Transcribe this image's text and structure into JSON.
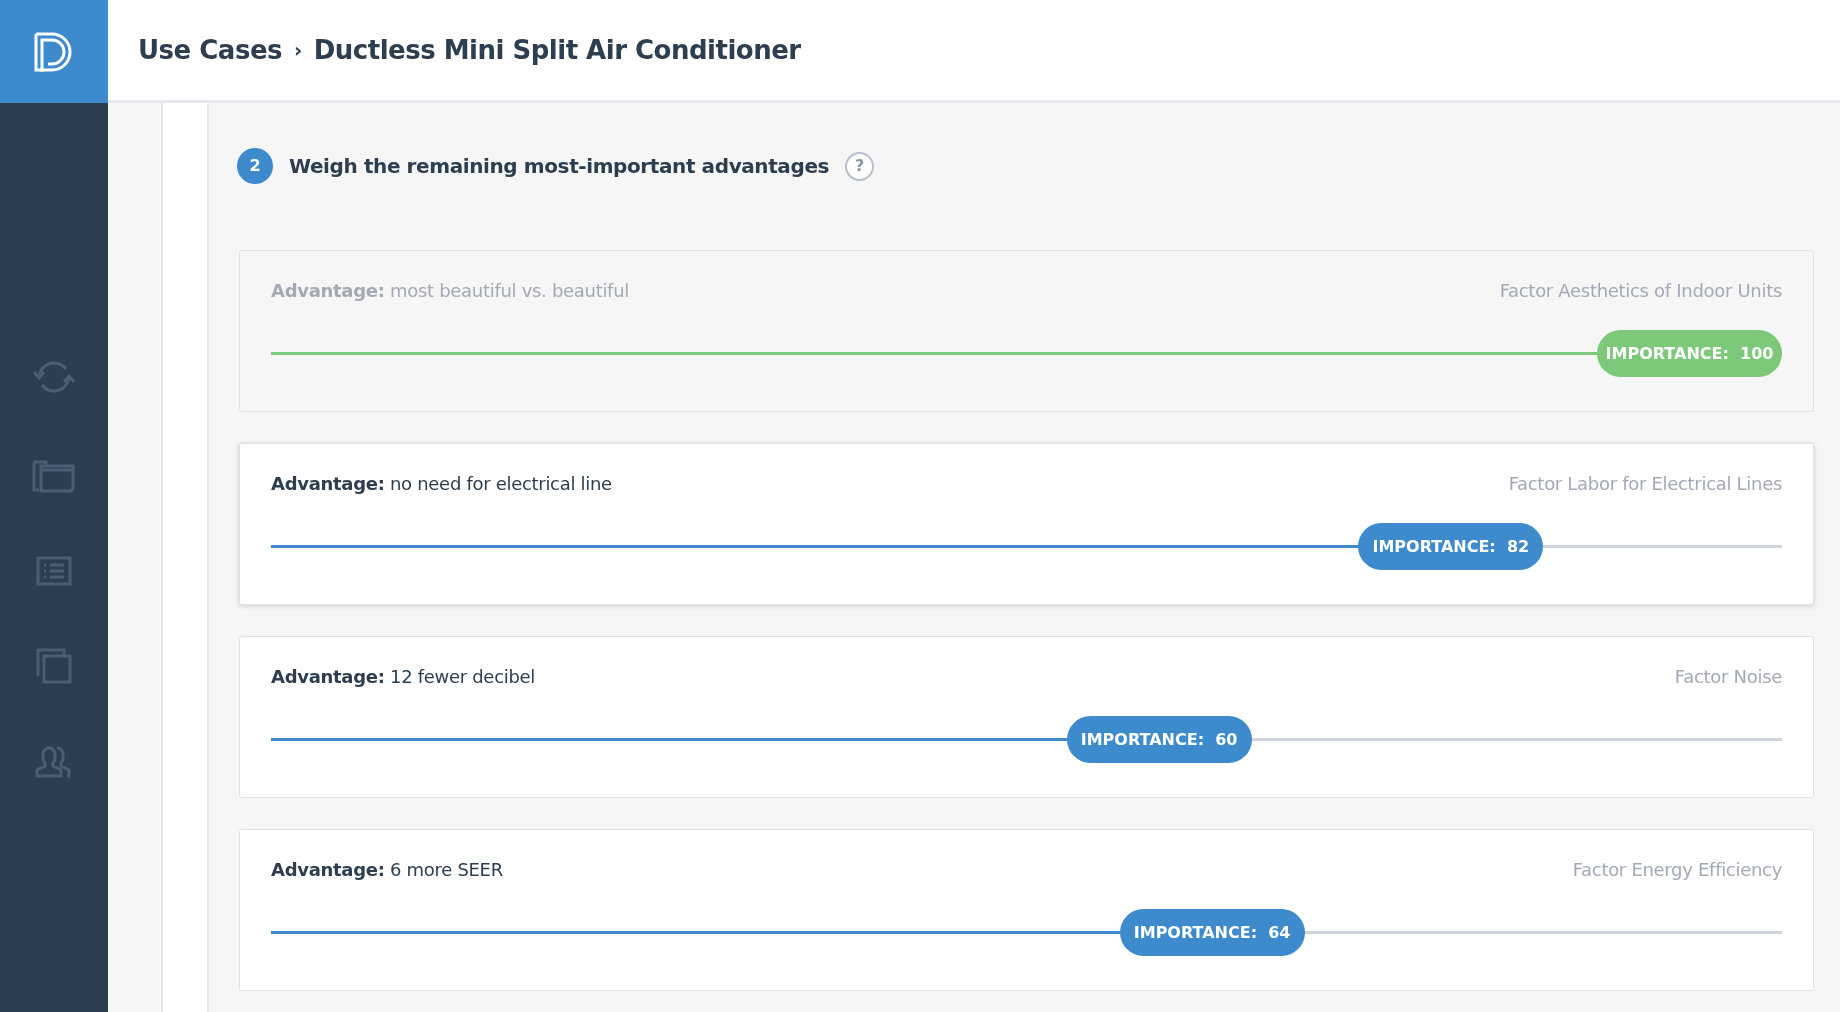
{
  "header": {
    "breadcrumb": [
      {
        "label": "Use Cases",
        "kind": "link"
      },
      {
        "label": "›",
        "kind": "separator"
      },
      {
        "label": "Ductless Mini Split Air Conditioner",
        "kind": "current"
      }
    ]
  },
  "step": {
    "number": "2",
    "title": "Weigh the remaining most-important advantages",
    "help": "?"
  },
  "advantages": [
    {
      "label": "Advantage:",
      "text": "most beautiful vs. beautiful",
      "factor": "Factor Aesthetics of Indoor Units",
      "importance": "IMPORTANCE:  100",
      "level": 1.0,
      "completed": true,
      "active": false
    },
    {
      "label": "Advantage:",
      "text": "no need for electrical line",
      "factor": "Factor Labor for Electrical Lines",
      "importance": "IMPORTANCE:  82",
      "level": 0.82,
      "completed": false,
      "active": true
    },
    {
      "label": "Advantage:",
      "text": "12 fewer decibel",
      "factor": "Factor Noise",
      "importance": "IMPORTANCE:  60",
      "level": 0.6,
      "completed": false,
      "active": false
    },
    {
      "label": "Advantage:",
      "text": "6 more SEER",
      "factor": "Factor Energy Efficiency",
      "importance": "IMPORTANCE:  64",
      "level": 0.64,
      "completed": false,
      "active": false
    }
  ]
}
